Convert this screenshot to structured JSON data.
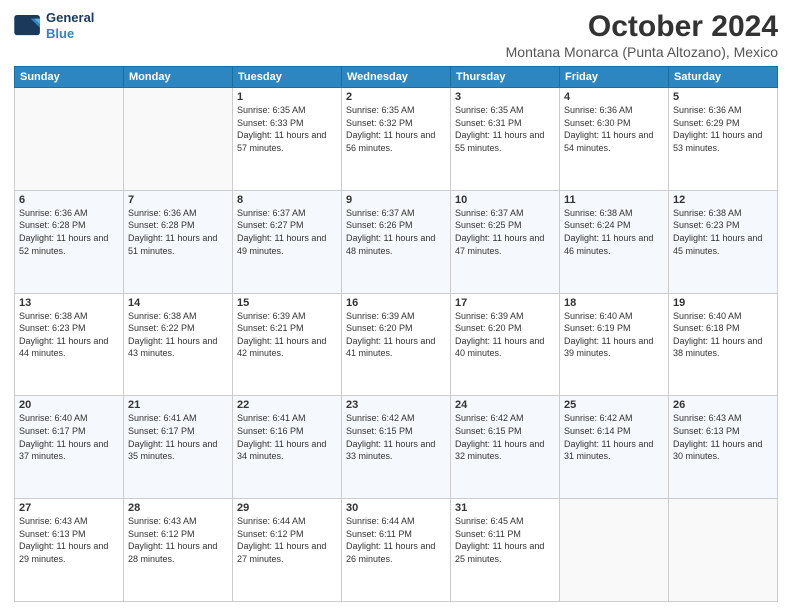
{
  "logo": {
    "line1": "General",
    "line2": "Blue"
  },
  "title": "October 2024",
  "subtitle": "Montana Monarca (Punta Altozano), Mexico",
  "days_of_week": [
    "Sunday",
    "Monday",
    "Tuesday",
    "Wednesday",
    "Thursday",
    "Friday",
    "Saturday"
  ],
  "weeks": [
    [
      {
        "day": "",
        "sunrise": "",
        "sunset": "",
        "daylight": ""
      },
      {
        "day": "",
        "sunrise": "",
        "sunset": "",
        "daylight": ""
      },
      {
        "day": "1",
        "sunrise": "Sunrise: 6:35 AM",
        "sunset": "Sunset: 6:33 PM",
        "daylight": "Daylight: 11 hours and 57 minutes."
      },
      {
        "day": "2",
        "sunrise": "Sunrise: 6:35 AM",
        "sunset": "Sunset: 6:32 PM",
        "daylight": "Daylight: 11 hours and 56 minutes."
      },
      {
        "day": "3",
        "sunrise": "Sunrise: 6:35 AM",
        "sunset": "Sunset: 6:31 PM",
        "daylight": "Daylight: 11 hours and 55 minutes."
      },
      {
        "day": "4",
        "sunrise": "Sunrise: 6:36 AM",
        "sunset": "Sunset: 6:30 PM",
        "daylight": "Daylight: 11 hours and 54 minutes."
      },
      {
        "day": "5",
        "sunrise": "Sunrise: 6:36 AM",
        "sunset": "Sunset: 6:29 PM",
        "daylight": "Daylight: 11 hours and 53 minutes."
      }
    ],
    [
      {
        "day": "6",
        "sunrise": "Sunrise: 6:36 AM",
        "sunset": "Sunset: 6:28 PM",
        "daylight": "Daylight: 11 hours and 52 minutes."
      },
      {
        "day": "7",
        "sunrise": "Sunrise: 6:36 AM",
        "sunset": "Sunset: 6:28 PM",
        "daylight": "Daylight: 11 hours and 51 minutes."
      },
      {
        "day": "8",
        "sunrise": "Sunrise: 6:37 AM",
        "sunset": "Sunset: 6:27 PM",
        "daylight": "Daylight: 11 hours and 49 minutes."
      },
      {
        "day": "9",
        "sunrise": "Sunrise: 6:37 AM",
        "sunset": "Sunset: 6:26 PM",
        "daylight": "Daylight: 11 hours and 48 minutes."
      },
      {
        "day": "10",
        "sunrise": "Sunrise: 6:37 AM",
        "sunset": "Sunset: 6:25 PM",
        "daylight": "Daylight: 11 hours and 47 minutes."
      },
      {
        "day": "11",
        "sunrise": "Sunrise: 6:38 AM",
        "sunset": "Sunset: 6:24 PM",
        "daylight": "Daylight: 11 hours and 46 minutes."
      },
      {
        "day": "12",
        "sunrise": "Sunrise: 6:38 AM",
        "sunset": "Sunset: 6:23 PM",
        "daylight": "Daylight: 11 hours and 45 minutes."
      }
    ],
    [
      {
        "day": "13",
        "sunrise": "Sunrise: 6:38 AM",
        "sunset": "Sunset: 6:23 PM",
        "daylight": "Daylight: 11 hours and 44 minutes."
      },
      {
        "day": "14",
        "sunrise": "Sunrise: 6:38 AM",
        "sunset": "Sunset: 6:22 PM",
        "daylight": "Daylight: 11 hours and 43 minutes."
      },
      {
        "day": "15",
        "sunrise": "Sunrise: 6:39 AM",
        "sunset": "Sunset: 6:21 PM",
        "daylight": "Daylight: 11 hours and 42 minutes."
      },
      {
        "day": "16",
        "sunrise": "Sunrise: 6:39 AM",
        "sunset": "Sunset: 6:20 PM",
        "daylight": "Daylight: 11 hours and 41 minutes."
      },
      {
        "day": "17",
        "sunrise": "Sunrise: 6:39 AM",
        "sunset": "Sunset: 6:20 PM",
        "daylight": "Daylight: 11 hours and 40 minutes."
      },
      {
        "day": "18",
        "sunrise": "Sunrise: 6:40 AM",
        "sunset": "Sunset: 6:19 PM",
        "daylight": "Daylight: 11 hours and 39 minutes."
      },
      {
        "day": "19",
        "sunrise": "Sunrise: 6:40 AM",
        "sunset": "Sunset: 6:18 PM",
        "daylight": "Daylight: 11 hours and 38 minutes."
      }
    ],
    [
      {
        "day": "20",
        "sunrise": "Sunrise: 6:40 AM",
        "sunset": "Sunset: 6:17 PM",
        "daylight": "Daylight: 11 hours and 37 minutes."
      },
      {
        "day": "21",
        "sunrise": "Sunrise: 6:41 AM",
        "sunset": "Sunset: 6:17 PM",
        "daylight": "Daylight: 11 hours and 35 minutes."
      },
      {
        "day": "22",
        "sunrise": "Sunrise: 6:41 AM",
        "sunset": "Sunset: 6:16 PM",
        "daylight": "Daylight: 11 hours and 34 minutes."
      },
      {
        "day": "23",
        "sunrise": "Sunrise: 6:42 AM",
        "sunset": "Sunset: 6:15 PM",
        "daylight": "Daylight: 11 hours and 33 minutes."
      },
      {
        "day": "24",
        "sunrise": "Sunrise: 6:42 AM",
        "sunset": "Sunset: 6:15 PM",
        "daylight": "Daylight: 11 hours and 32 minutes."
      },
      {
        "day": "25",
        "sunrise": "Sunrise: 6:42 AM",
        "sunset": "Sunset: 6:14 PM",
        "daylight": "Daylight: 11 hours and 31 minutes."
      },
      {
        "day": "26",
        "sunrise": "Sunrise: 6:43 AM",
        "sunset": "Sunset: 6:13 PM",
        "daylight": "Daylight: 11 hours and 30 minutes."
      }
    ],
    [
      {
        "day": "27",
        "sunrise": "Sunrise: 6:43 AM",
        "sunset": "Sunset: 6:13 PM",
        "daylight": "Daylight: 11 hours and 29 minutes."
      },
      {
        "day": "28",
        "sunrise": "Sunrise: 6:43 AM",
        "sunset": "Sunset: 6:12 PM",
        "daylight": "Daylight: 11 hours and 28 minutes."
      },
      {
        "day": "29",
        "sunrise": "Sunrise: 6:44 AM",
        "sunset": "Sunset: 6:12 PM",
        "daylight": "Daylight: 11 hours and 27 minutes."
      },
      {
        "day": "30",
        "sunrise": "Sunrise: 6:44 AM",
        "sunset": "Sunset: 6:11 PM",
        "daylight": "Daylight: 11 hours and 26 minutes."
      },
      {
        "day": "31",
        "sunrise": "Sunrise: 6:45 AM",
        "sunset": "Sunset: 6:11 PM",
        "daylight": "Daylight: 11 hours and 25 minutes."
      },
      {
        "day": "",
        "sunrise": "",
        "sunset": "",
        "daylight": ""
      },
      {
        "day": "",
        "sunrise": "",
        "sunset": "",
        "daylight": ""
      }
    ]
  ]
}
